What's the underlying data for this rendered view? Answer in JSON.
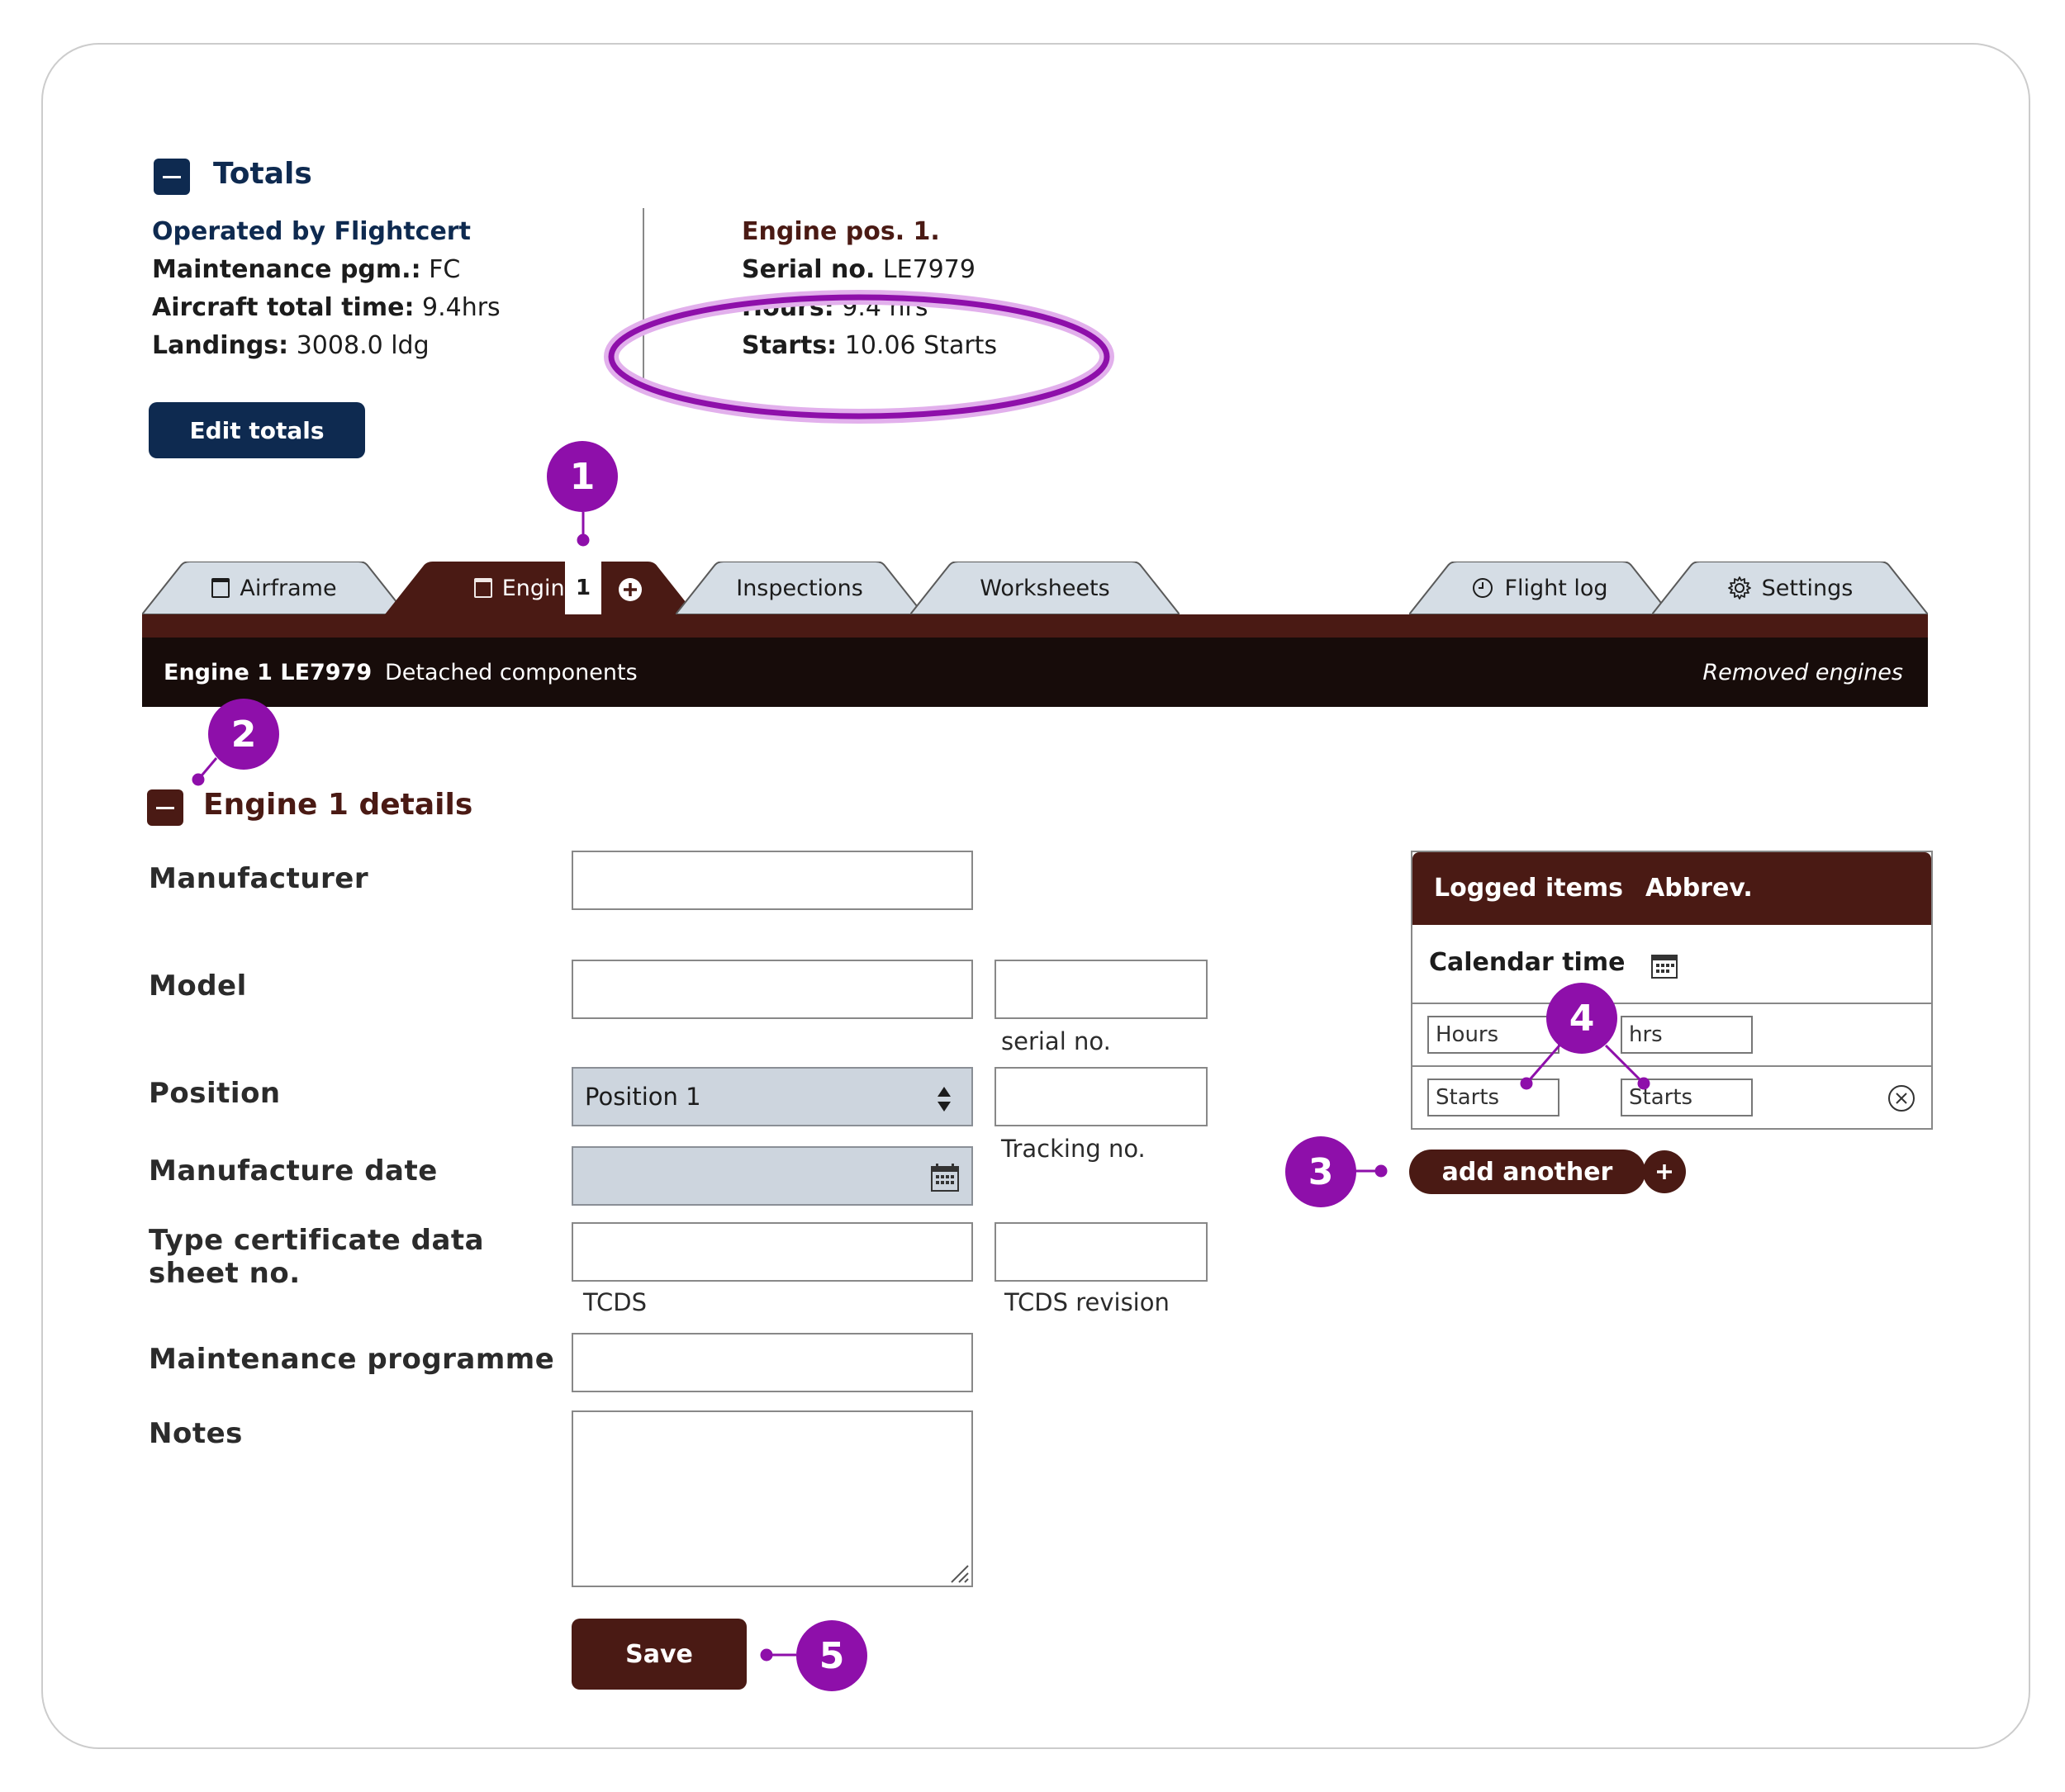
{
  "totals": {
    "title": "Totals",
    "operated_by": "Operated by Flightcert",
    "maintenance_pgm_label": "Maintenance pgm.:",
    "maintenance_pgm_value": "FC",
    "aircraft_total_time_label": "Aircraft total time:",
    "aircraft_total_time_value": "9.4hrs",
    "landings_label": "Landings:",
    "landings_value": "3008.0 ldg",
    "edit_button": "Edit totals",
    "engine": {
      "position": "Engine pos. 1.",
      "serial_label": "Serial no.",
      "serial_value": "LE7979",
      "hours_label": "Hours:",
      "hours_value": "9.4 hrs",
      "starts_label": "Starts:",
      "starts_value": "10.06 Starts"
    }
  },
  "tabs": {
    "airframe": "Airframe",
    "engines": "Engines",
    "engines_count": "1",
    "inspections": "Inspections",
    "worksheets": "Worksheets",
    "flight_log": "Flight log",
    "settings": "Settings"
  },
  "subnav": {
    "engine": "Engine 1 LE7979",
    "detached": "Detached components",
    "removed": "Removed engines"
  },
  "details": {
    "title": "Engine 1 details",
    "manufacturer": "Manufacturer",
    "model": "Model",
    "serial_hint": "serial no.",
    "position": "Position",
    "position_value": "Position 1",
    "tracking_hint": "Tracking no.",
    "manufacture_date": "Manufacture date",
    "tcds_label_1": "Type certificate data",
    "tcds_label_2": "sheet no.",
    "tcds_hint": "TCDS",
    "tcds_revision_hint": "TCDS revision",
    "maintenance_programme": "Maintenance programme",
    "notes": "Notes",
    "save": "Save"
  },
  "logged_items": {
    "col_items": "Logged items",
    "col_abbrev": "Abbrev.",
    "calendar_time": "Calendar time",
    "rows": [
      {
        "item": "Hours",
        "abbrev": "hrs"
      },
      {
        "item": "Starts",
        "abbrev": "Starts"
      }
    ],
    "add_another": "add another"
  },
  "markers": [
    "1",
    "2",
    "3",
    "4",
    "5"
  ],
  "colors": {
    "navy": "#0e2a50",
    "maroon": "#4a1a14",
    "subnav": "#170c0a",
    "tab_inactive": "#d5dde5",
    "marker": "#8e0faa",
    "highlight": "#e2b0ec"
  }
}
